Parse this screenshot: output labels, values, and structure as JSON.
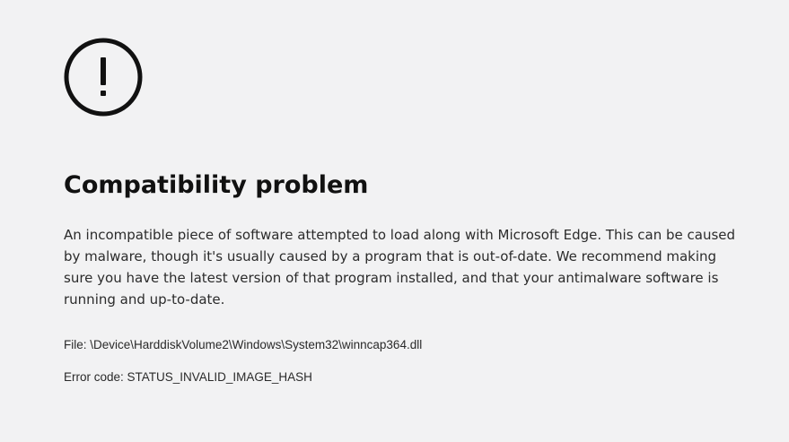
{
  "icon": "alert-circle-icon",
  "title": "Compatibility problem",
  "description": "An incompatible piece of software attempted to load along with Microsoft Edge. This can be caused by malware, though it's usually caused by a program that is out-of-date. We recommend making sure you have the latest version of that program installed, and that your antimalware software is running and up-to-date.",
  "file": {
    "label": "File:",
    "value": "\\Device\\HarddiskVolume2\\Windows\\System32\\winncap364.dll"
  },
  "error": {
    "label": "Error code:",
    "value": "STATUS_INVALID_IMAGE_HASH"
  },
  "colors": {
    "background": "#f2f2f3",
    "text": "#111111"
  }
}
